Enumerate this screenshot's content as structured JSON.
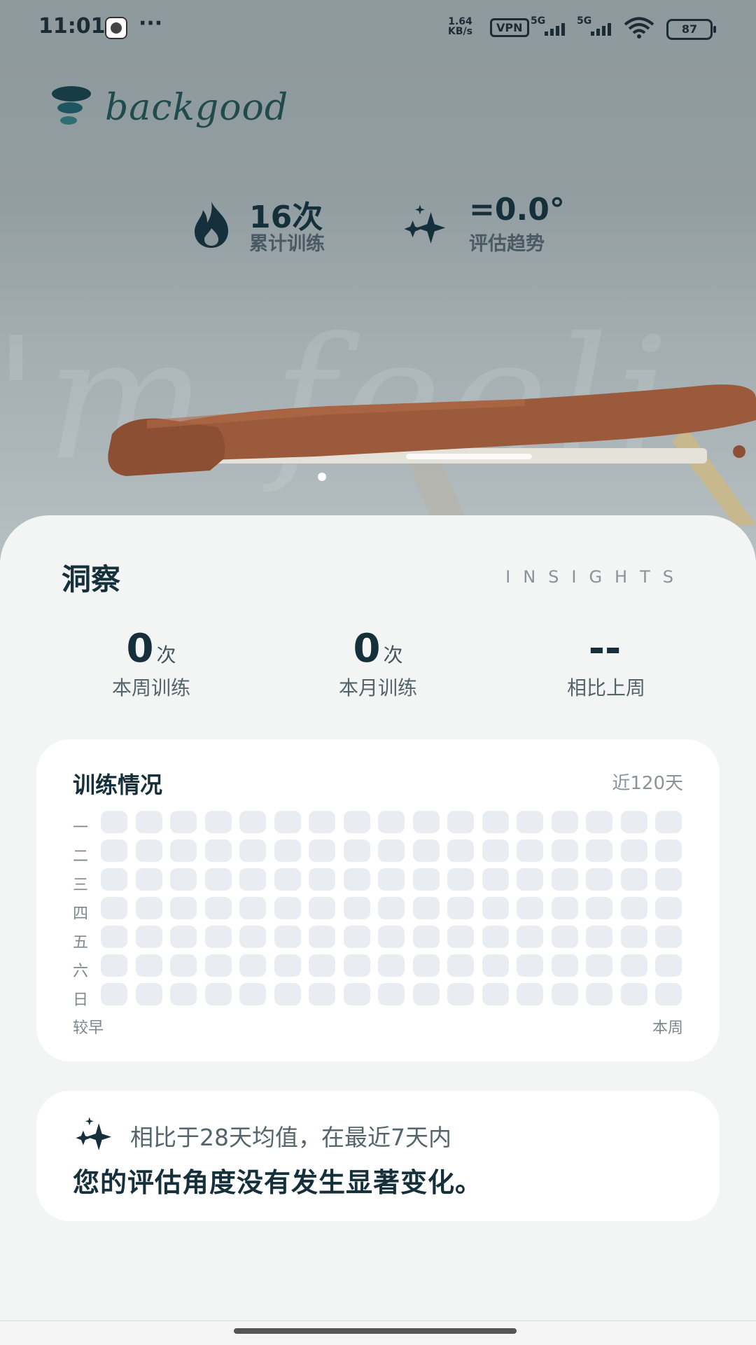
{
  "status_bar": {
    "time": "11:01",
    "more": "···",
    "net_speed_top": "1.64",
    "net_speed_bottom": "KB/s",
    "vpn": "VPN",
    "sim1": "5G",
    "sim2": "5G",
    "battery": "87"
  },
  "brand": {
    "name": "backgood"
  },
  "stats": {
    "total": {
      "value": "16次",
      "label": "累计训练",
      "icon": "flame-icon"
    },
    "trend": {
      "value": "=0.0°",
      "label": "评估趋势",
      "icon": "sparkle-icon"
    }
  },
  "insights": {
    "title": "洞察",
    "subtitle": "INSIGHTS",
    "metrics": [
      {
        "value": "0",
        "unit": "次",
        "label": "本周训练"
      },
      {
        "value": "0",
        "unit": "次",
        "label": "本月训练"
      },
      {
        "value": "--",
        "unit": "",
        "label": "相比上周"
      }
    ]
  },
  "training": {
    "title": "训练情况",
    "range": "近120天",
    "days": [
      "一",
      "二",
      "三",
      "四",
      "五",
      "六",
      "日"
    ],
    "columns": 17,
    "footer_left": "较早",
    "footer_right": "本周",
    "cell_color": "#e9edf1"
  },
  "summary": {
    "icon": "sparkle-icon",
    "line1": "相比于28天均值，在最近7天内",
    "line2": "您的评估角度没有发生显著变化。"
  },
  "colors": {
    "accent": "#15303a",
    "brand": "#1f4b4d",
    "bench": "#9b5a3c"
  }
}
